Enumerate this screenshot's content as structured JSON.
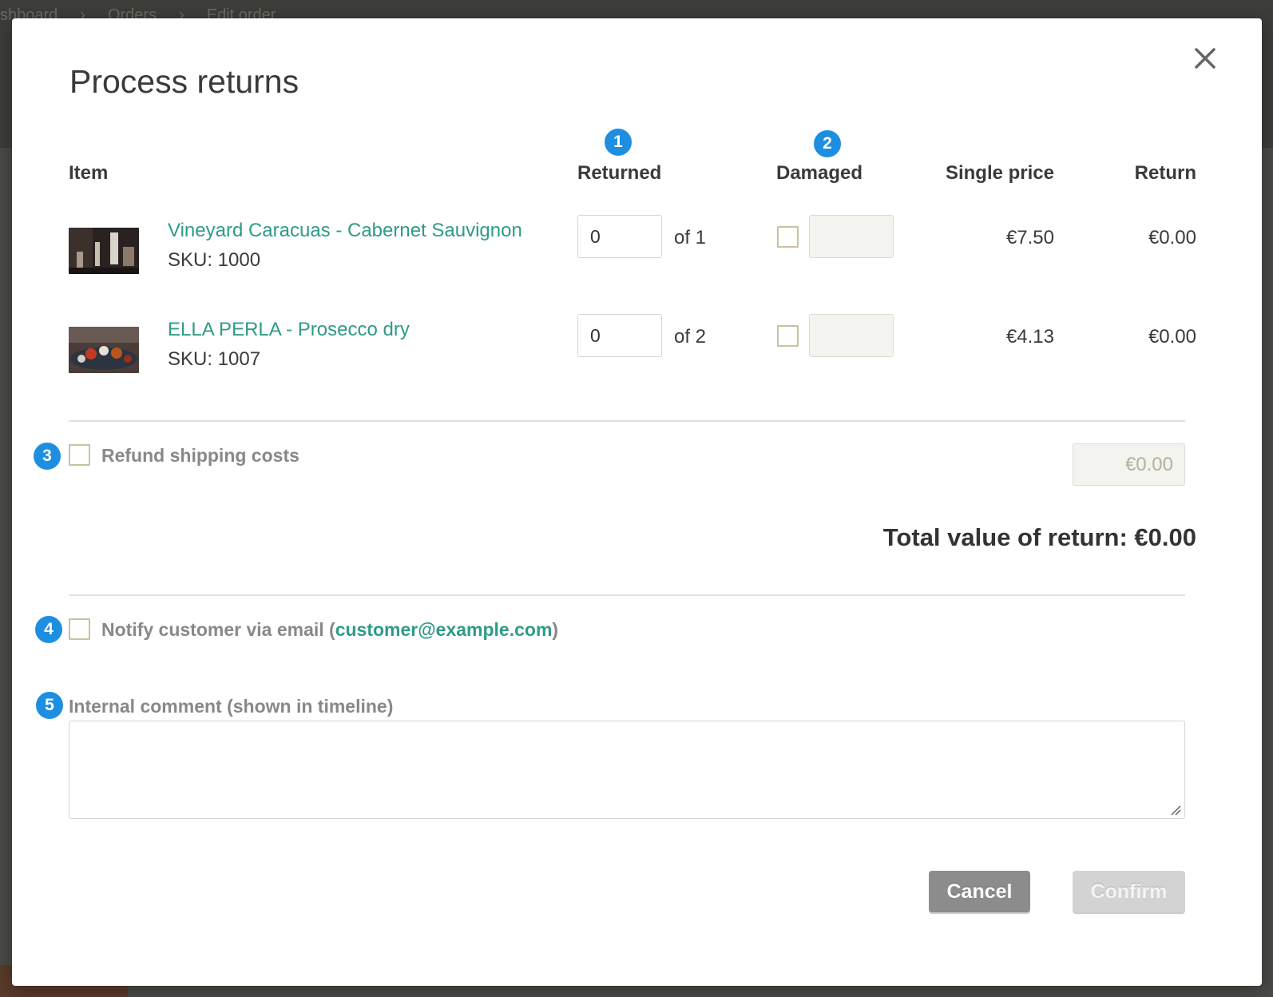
{
  "background": {
    "breadcrumb": [
      "shboard",
      "Orders",
      "Edit order"
    ]
  },
  "modal": {
    "title": "Process returns",
    "close_icon": "close-icon"
  },
  "columns": {
    "item": "Item",
    "returned": "Returned",
    "damaged": "Damaged",
    "single_price": "Single price",
    "return": "Return"
  },
  "badges": [
    "1",
    "2",
    "3",
    "4",
    "5"
  ],
  "items": [
    {
      "name": "Vineyard Caracuas - Cabernet Sauvignon",
      "sku": "SKU: 1000",
      "returned_value": "0",
      "of_text": "of 1",
      "damaged_checked": false,
      "single_price": "€7.50",
      "return_value": "€0.00"
    },
    {
      "name": "ELLA PERLA - Prosecco dry",
      "sku": "SKU: 1007",
      "returned_value": "0",
      "of_text": "of 2",
      "damaged_checked": false,
      "single_price": "€4.13",
      "return_value": "€0.00"
    }
  ],
  "shipping": {
    "label": "Refund shipping costs",
    "value": "€0.00"
  },
  "total": {
    "label": "Total value of return: €0.00"
  },
  "notify": {
    "label_prefix": "Notify customer via email (",
    "email": "customer@example.com",
    "label_suffix": ")"
  },
  "comment": {
    "label": "Internal comment (shown in timeline)",
    "value": ""
  },
  "buttons": {
    "cancel": "Cancel",
    "confirm": "Confirm"
  },
  "colors": {
    "accent_link": "#2e9b87",
    "badge": "#1e8fe0",
    "cancel_button": "#8c8c8c",
    "confirm_button_disabled": "#d3d3d3"
  }
}
